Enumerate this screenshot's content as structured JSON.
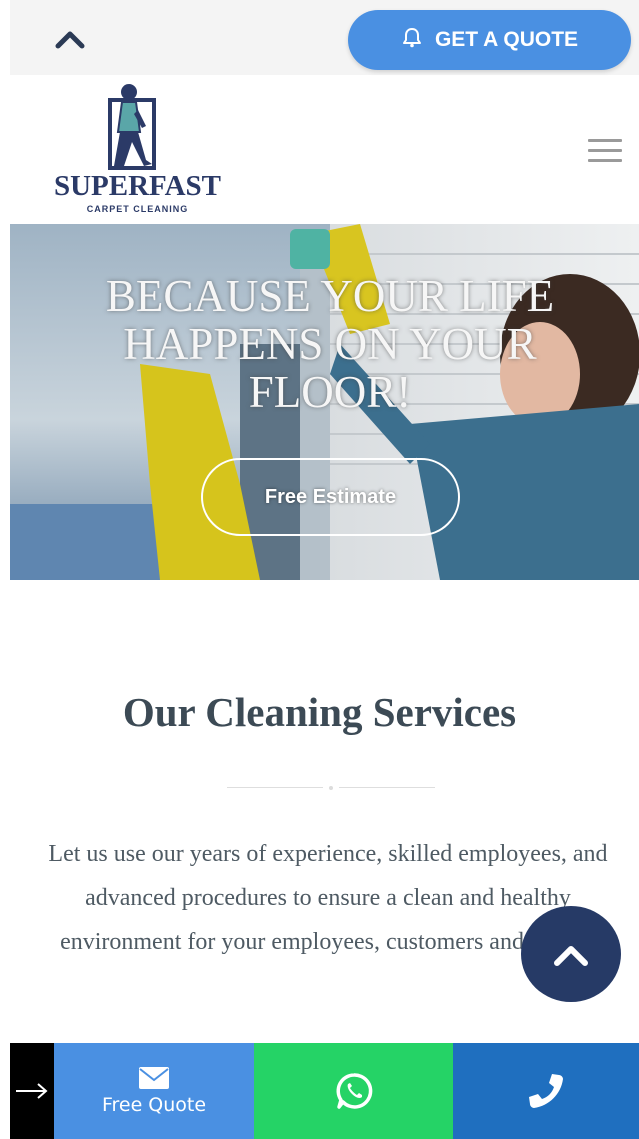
{
  "topbar": {
    "quote_button_label": "GET A QUOTE",
    "accent_color": "#4a90e2"
  },
  "logo": {
    "wordmark": "SUPERFAST",
    "subtitle": "CARPET CLEANING",
    "brand_color": "#2b3a67"
  },
  "hero": {
    "title": "BECAUSE YOUR LIFE HAPPENS ON YOUR FLOOR!",
    "cta_label": "Free Estimate"
  },
  "services": {
    "title": "Our Cleaning Services",
    "text": "Let us use our years of experience, skilled employees, and advanced procedures to ensure a clean and healthy environment for your employees, customers and guests."
  },
  "bottom_bar": {
    "quote_label": "Free Quote",
    "colors": {
      "quote": "#4a90e2",
      "whatsapp": "#25d366",
      "call": "#1f6fbf",
      "arrow": "#000000"
    }
  },
  "icons": [
    "chevron-up-icon",
    "bell-icon",
    "menu-icon",
    "arrow-right-icon",
    "envelope-icon",
    "whatsapp-icon",
    "phone-icon"
  ]
}
